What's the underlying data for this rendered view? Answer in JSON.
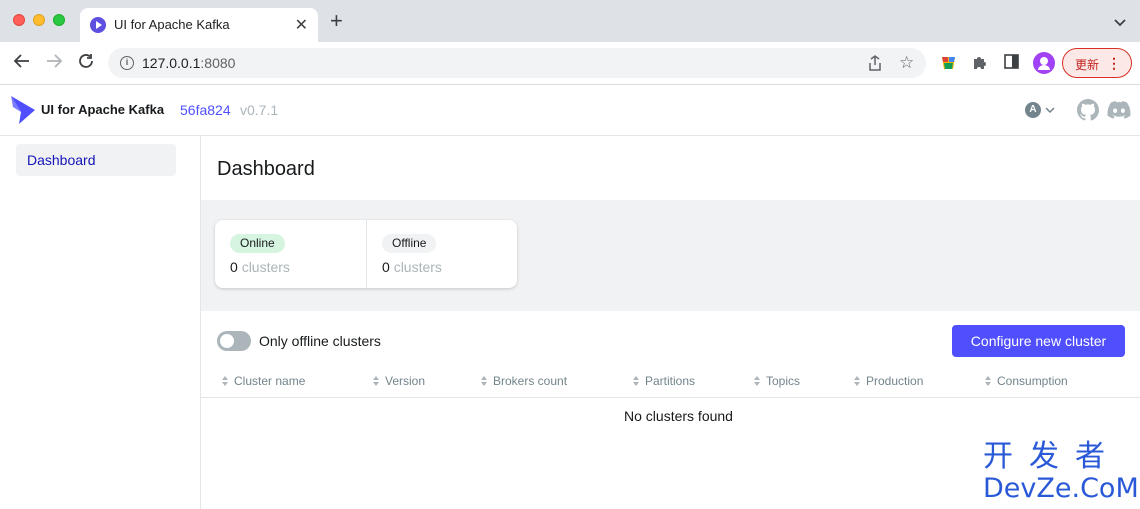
{
  "browser": {
    "tab_title": "UI for Apache Kafka",
    "url_host": "127.0.0.1",
    "url_port": ":8080",
    "update_label": "更新"
  },
  "header": {
    "app_title": "UI for Apache Kafka",
    "commit": "56fa824",
    "version": "v0.7.1",
    "theme_letter": "A"
  },
  "sidebar": {
    "items": [
      {
        "label": "Dashboard",
        "active": true
      }
    ]
  },
  "main": {
    "title": "Dashboard",
    "metrics": [
      {
        "pill": "Online",
        "value": "0",
        "unit": "clusters"
      },
      {
        "pill": "Offline",
        "value": "0",
        "unit": "clusters"
      }
    ],
    "toggle_label": "Only offline clusters",
    "configure_label": "Configure new cluster",
    "columns": [
      "Cluster name",
      "Version",
      "Brokers count",
      "Partitions",
      "Topics",
      "Production",
      "Consumption"
    ],
    "empty_text": "No clusters found"
  },
  "watermark": {
    "cn": "开发者",
    "en": "DevZe.CoM"
  },
  "colors": {
    "accent": "#4f4ffe",
    "online": "#d6f5e0"
  }
}
